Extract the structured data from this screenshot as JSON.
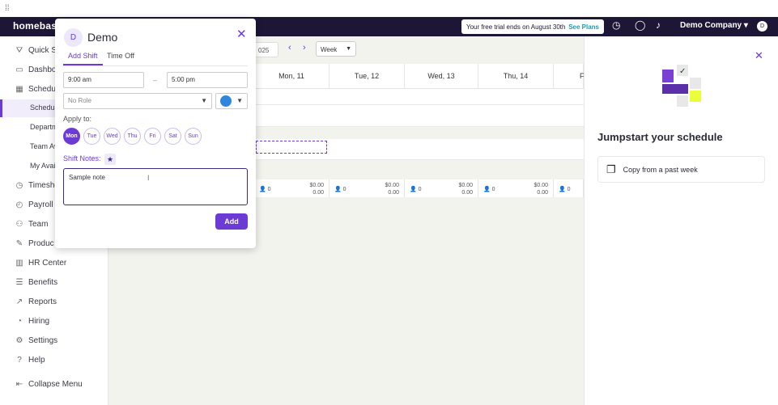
{
  "browser": {
    "icon": "grid-icon"
  },
  "topbar": {
    "logo": "homebase",
    "trial_text": "Your free trial ends on August 30th",
    "see_plans": "See Plans",
    "company": "Demo Company ▾",
    "avatar_initial": "D"
  },
  "sidebar": {
    "items": [
      {
        "label": "Quick S",
        "icon": "⛛"
      },
      {
        "label": "Dashbo",
        "icon": "▭"
      },
      {
        "label": "Schedu",
        "icon": "▦"
      },
      {
        "label": "Timeshe",
        "icon": "◷"
      },
      {
        "label": "Payroll",
        "icon": "◴"
      },
      {
        "label": "Team",
        "icon": "⚇"
      },
      {
        "label": "Produc",
        "icon": "✎"
      },
      {
        "label": "HR Center",
        "icon": "▥"
      },
      {
        "label": "Benefits",
        "icon": "☰"
      },
      {
        "label": "Reports",
        "icon": "↗"
      },
      {
        "label": "Hiring",
        "icon": "◔"
      },
      {
        "label": "Settings",
        "icon": "⚙"
      },
      {
        "label": "Help",
        "icon": "?"
      },
      {
        "label": "Collapse Menu",
        "icon": "⇤"
      }
    ],
    "subitems": [
      "Schedul",
      "Departm",
      "Team Av",
      "My Avail"
    ]
  },
  "calendar": {
    "date_range": "025",
    "view": "Week",
    "days": [
      "Mon, 11",
      "Tue, 12",
      "Wed, 13",
      "Thu, 14",
      "F"
    ],
    "totals": [
      {
        "count": "0",
        "amount": "$0.00",
        "hours": "0.00"
      },
      {
        "count": "0",
        "amount": "$0.00",
        "hours": "0.00"
      },
      {
        "count": "0",
        "amount": "$0.00",
        "hours": "0.00"
      },
      {
        "count": "0",
        "amount": "$0.00",
        "hours": "0.00"
      },
      {
        "count": "0",
        "amount": "",
        "hours": ""
      }
    ]
  },
  "right_panel": {
    "title": "Jumpstart your schedule",
    "copy_label": "Copy from a past week"
  },
  "modal": {
    "avatar_initial": "D",
    "title": "Demo",
    "tabs": [
      "Add Shift",
      "Time Off"
    ],
    "start_time": "9:00 am",
    "end_time": "5:00 pm",
    "separator": "–",
    "role_placeholder": "No Role",
    "color": "#2e86de",
    "apply_to_label": "Apply to:",
    "days": [
      "Mon",
      "Tue",
      "Wed",
      "Thu",
      "Fri",
      "Sat",
      "Sun"
    ],
    "selected_day": "Mon",
    "notes_label": "Shift Notes:",
    "notes_value": "Sample note",
    "add_button": "Add"
  },
  "colors": {
    "accent": "#6c3bd5",
    "topbar": "#1d1636",
    "teal": "#1a9fb0"
  }
}
